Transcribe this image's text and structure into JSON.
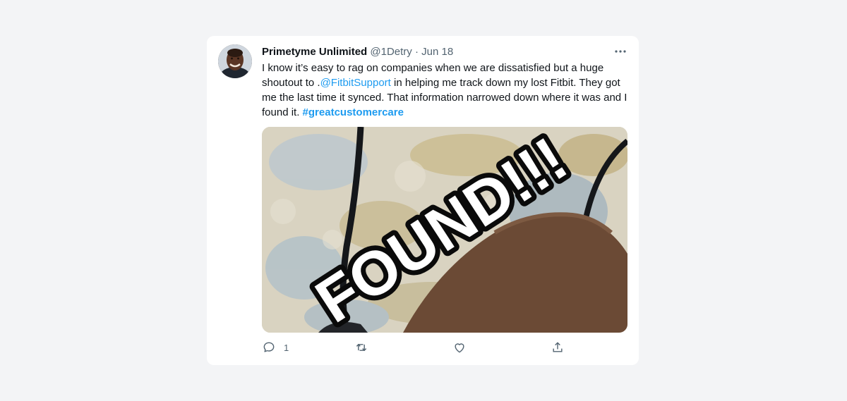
{
  "tweet": {
    "author_name": "Primetyme Unlimited",
    "handle": "@1Detry",
    "separator": "·",
    "date": "Jun 18",
    "text_part1": "I know it’s easy to rag on companies when we are dissatisfied but a huge shoutout to .",
    "mention": "@FitbitSupport",
    "text_part2": " in helping me track down my lost Fitbit. They got me the last time it synced. That information narrowed down where it was and I found it. ",
    "hashtag": "#greatcustomercare",
    "image_overlay_text": "FOUND!!!",
    "reply_count": "1"
  },
  "colors": {
    "accent": "#1d9bf0",
    "text": "#0f1419",
    "muted": "#536471",
    "background": "#f3f4f6"
  },
  "icons": {
    "more": "more-horizontal-icon",
    "reply": "reply-icon",
    "retweet": "retweet-icon",
    "like": "heart-icon",
    "share": "share-icon"
  }
}
